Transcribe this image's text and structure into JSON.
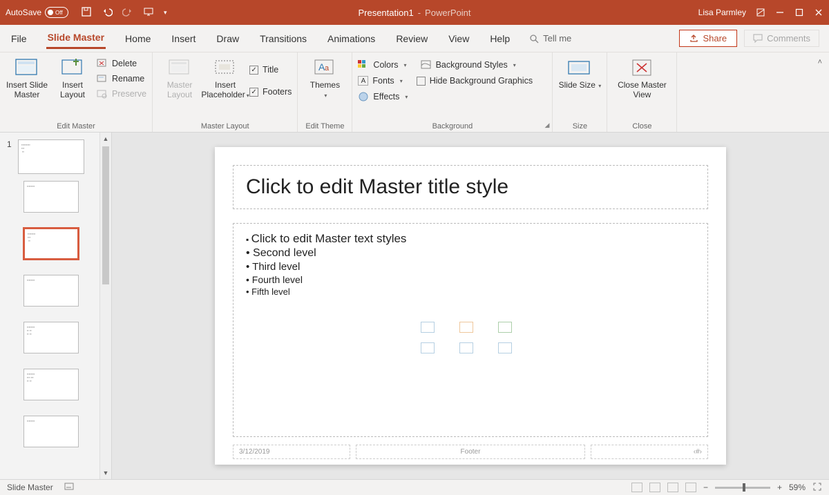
{
  "titlebar": {
    "autosave_label": "AutoSave",
    "autosave_state": "Off",
    "document": "Presentation1",
    "separator": "-",
    "app": "PowerPoint",
    "user": "Lisa Parmley"
  },
  "tabs": {
    "file": "File",
    "slide_master": "Slide Master",
    "home": "Home",
    "insert": "Insert",
    "draw": "Draw",
    "transitions": "Transitions",
    "animations": "Animations",
    "review": "Review",
    "view": "View",
    "help": "Help",
    "tellme": "Tell me",
    "share": "Share",
    "comments": "Comments"
  },
  "ribbon": {
    "edit_master": {
      "label": "Edit Master",
      "insert_slide_master": "Insert Slide Master",
      "insert_layout": "Insert Layout",
      "delete": "Delete",
      "rename": "Rename",
      "preserve": "Preserve"
    },
    "master_layout": {
      "label": "Master Layout",
      "master_layout_btn": "Master Layout",
      "insert_placeholder": "Insert Placeholder",
      "title_chk": "Title",
      "footers_chk": "Footers"
    },
    "edit_theme": {
      "label": "Edit Theme",
      "themes": "Themes"
    },
    "background": {
      "label": "Background",
      "colors": "Colors",
      "fonts": "Fonts",
      "effects": "Effects",
      "bg_styles": "Background Styles",
      "hide_bg": "Hide Background Graphics"
    },
    "size": {
      "label": "Size",
      "slide_size": "Slide Size"
    },
    "close": {
      "label": "Close",
      "close_master": "Close Master View"
    }
  },
  "slide": {
    "title_placeholder": "Click to edit Master title style",
    "bullets": [
      "Click to edit Master text styles",
      "Second level",
      "Third level",
      "Fourth level",
      "Fifth level"
    ],
    "date": "3/12/2019",
    "footer": "Footer",
    "slidenum": "‹#›"
  },
  "thumbs": {
    "num": "1"
  },
  "status": {
    "mode": "Slide Master",
    "zoom": "59%",
    "plus": "+",
    "minus": "−"
  }
}
